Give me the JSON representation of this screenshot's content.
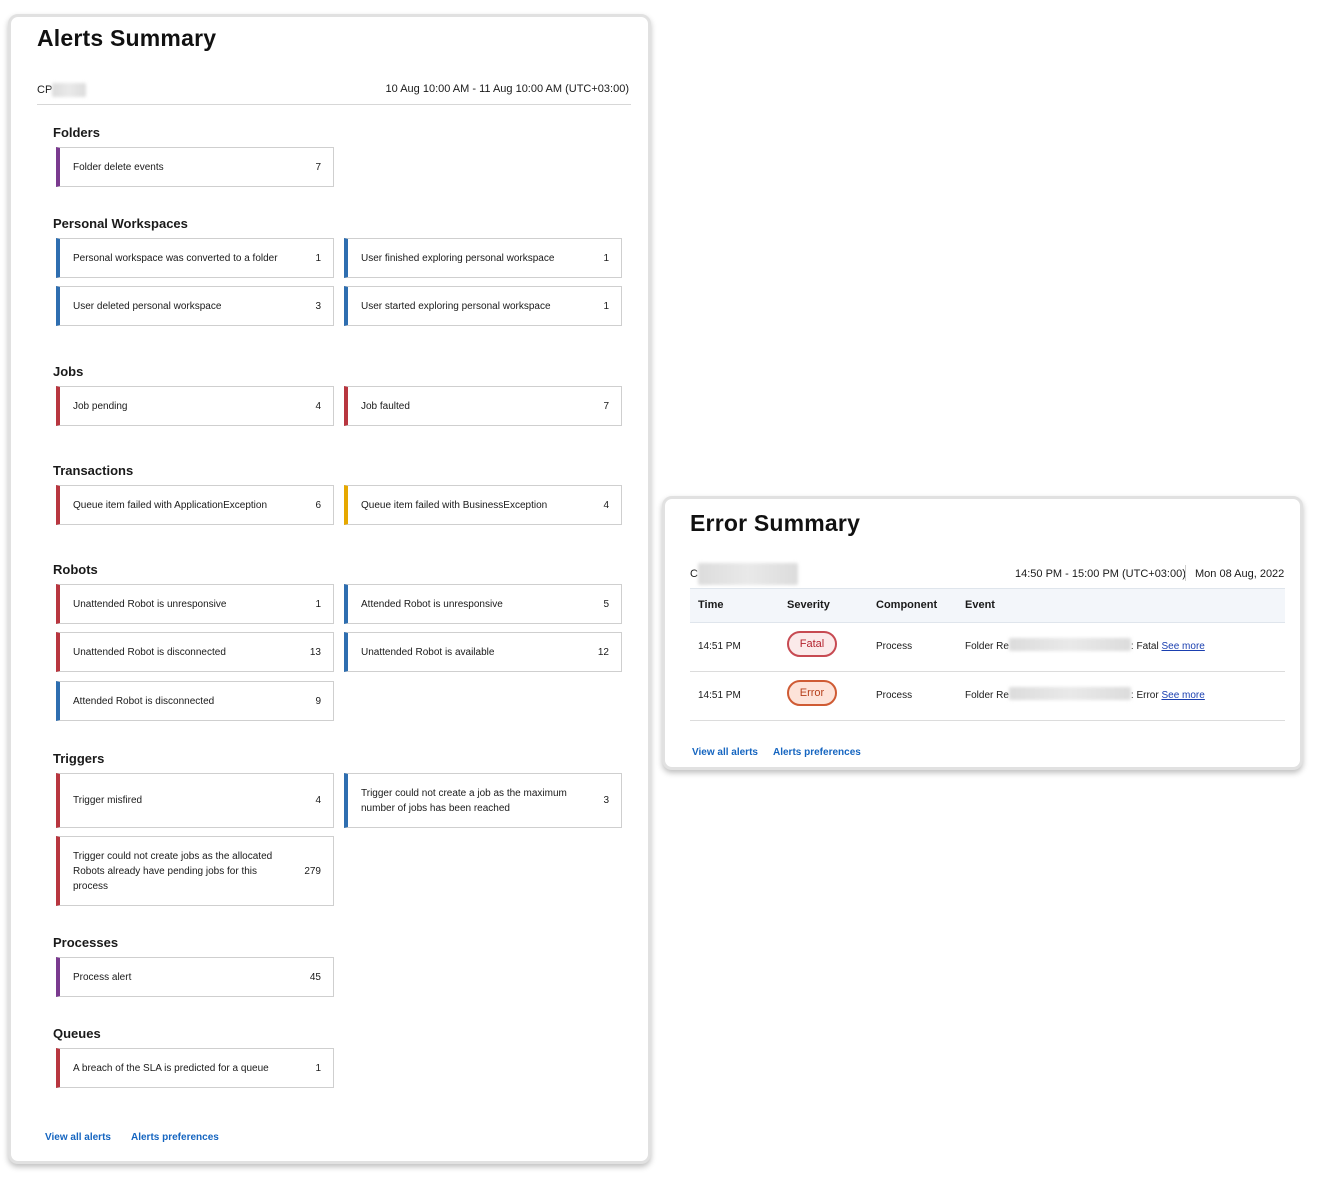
{
  "alerts_summary": {
    "title": "Alerts Summary",
    "tenant_prefix": "CP",
    "date_range": "10 Aug 10:00 AM - 11 Aug 10:00 AM (UTC+03:00)",
    "sections": {
      "folders": {
        "title": "Folders",
        "items": [
          {
            "label": "Folder delete events",
            "count": "7"
          }
        ]
      },
      "personal_workspaces": {
        "title": "Personal Workspaces",
        "items": [
          {
            "label": "Personal workspace was converted to a folder",
            "count": "1"
          },
          {
            "label": "User finished exploring personal workspace",
            "count": "1"
          },
          {
            "label": "User deleted personal workspace",
            "count": "3"
          },
          {
            "label": "User started exploring personal workspace",
            "count": "1"
          }
        ]
      },
      "jobs": {
        "title": "Jobs",
        "items": [
          {
            "label": "Job pending",
            "count": "4"
          },
          {
            "label": "Job faulted",
            "count": "7"
          }
        ]
      },
      "transactions": {
        "title": "Transactions",
        "items": [
          {
            "label": "Queue item failed with ApplicationException",
            "count": "6"
          },
          {
            "label": "Queue item failed with BusinessException",
            "count": "4"
          }
        ]
      },
      "robots": {
        "title": "Robots",
        "items": [
          {
            "label": "Unattended Robot is unresponsive",
            "count": "1"
          },
          {
            "label": "Attended Robot is unresponsive",
            "count": "5"
          },
          {
            "label": "Unattended Robot is disconnected",
            "count": "13"
          },
          {
            "label": "Unattended Robot is available",
            "count": "12"
          },
          {
            "label": "Attended Robot is disconnected",
            "count": "9"
          }
        ]
      },
      "triggers": {
        "title": "Triggers",
        "items": [
          {
            "label": "Trigger misfired",
            "count": "4"
          },
          {
            "label": "Trigger could not create a job as the maximum number of jobs has been reached",
            "count": "3"
          },
          {
            "label": "Trigger could not create jobs as the allocated Robots already have pending jobs for this process",
            "count": "279"
          }
        ]
      },
      "processes": {
        "title": "Processes",
        "items": [
          {
            "label": "Process alert",
            "count": "45"
          }
        ]
      },
      "queues": {
        "title": "Queues",
        "items": [
          {
            "label": "A breach of the SLA is predicted for a queue",
            "count": "1"
          }
        ]
      }
    },
    "footer": {
      "view_all": "View all alerts",
      "preferences": "Alerts preferences"
    }
  },
  "error_summary": {
    "title": "Error Summary",
    "tenant_prefix": "C",
    "time_range": "14:50 PM - 15:00 PM (UTC+03:00)",
    "date": "Mon 08 Aug, 2022",
    "columns": {
      "time": "Time",
      "severity": "Severity",
      "component": "Component",
      "event": "Event"
    },
    "rows": [
      {
        "time": "14:51 PM",
        "severity": "Fatal",
        "component": "Process",
        "event_prefix": "Folder Re",
        "event_suffix": ": Fatal",
        "link": "See more"
      },
      {
        "time": "14:51 PM",
        "severity": "Error",
        "component": "Process",
        "event_prefix": "Folder Re",
        "event_suffix": ": Error",
        "link": "See more"
      }
    ],
    "footer": {
      "view_all": "View all alerts",
      "preferences": "Alerts preferences"
    }
  },
  "colors": {
    "purple": "#7a3a8f",
    "blue": "#2e6eb0",
    "red": "#b8363f",
    "yellow": "#e6a800",
    "link": "#1565c0"
  }
}
